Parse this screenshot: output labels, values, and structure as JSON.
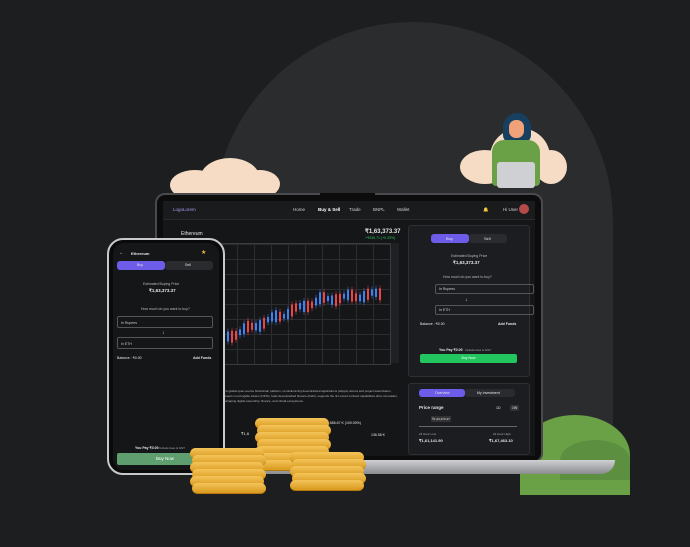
{
  "app": {
    "logo": "LogoLorem",
    "nav": [
      "Home",
      "Buy & Sell",
      "Trade",
      "BNPL",
      "Wallet"
    ],
    "user_greeting": "Hi User"
  },
  "market": {
    "asset": "Ethereum",
    "price": "₹1,63,373.37",
    "change": "+₹936.71 (+0.33%)",
    "description": "first global open-source blockchain platform, revolutionizing decentralized applications (dApps) across and project tokenization, powers non-fungible tokens (NFTs), fuels decentralized finance (DeFi), supports the rk's smart contract capabilities drive innovation, reshaping digital ownership, finance, and virtual ecosystems.",
    "stat_left": "₹1,6",
    "stat_right_a": "133,886.67 K (100.00%)",
    "stat_right_b": "136.58 K",
    "stat_right_c": "136.58 K",
    "range_label": "1D",
    "range_values": [
      "1W",
      "1M"
    ]
  },
  "trade_panel": {
    "tabs": [
      "Buy",
      "Sell"
    ],
    "estimated_label": "Estimated Buying Price",
    "estimated_price": "₹1,63,373.37",
    "question": "How much do you want to buy?",
    "in_rupees": "In Rupees",
    "in_eth": "In ETH",
    "balance_label": "Balance : ₹0.00",
    "add_funds": "Add Funds",
    "you_pay": "You Pay ₹0.00",
    "fees_note": "Include fees & GST",
    "buy_now": "Buy Now"
  },
  "overview": {
    "tabs": [
      "Overview",
      "My Investment"
    ],
    "price_range": "Price range",
    "range_btns": [
      "1D",
      "1W"
    ],
    "current_tag": "₹1,63,373.37",
    "low_label": "24 Hour Low",
    "low_value": "₹1,61,141.90",
    "high_label": "24 Hour High",
    "high_value": "₹1,67,463.10"
  },
  "phone": {
    "asset": "Ethereum",
    "tabs": [
      "Buy",
      "Sell"
    ],
    "estimated_label": "Estimated Buying Price",
    "estimated_price": "₹1,63,373.37",
    "question": "How much do you want to buy?",
    "in_rupees": "In Rupees",
    "in_eth": "In ETH",
    "balance_label": "Balance : ₹0.00",
    "add_funds": "Add Funds",
    "you_pay": "You Pay ₹0.00",
    "fees_note": "Include fees & GST",
    "buy_now": "Buy Now"
  },
  "colors": {
    "accent": "#6c5ce7",
    "buy_green": "#22c55e",
    "candle_up": "#3b82f6",
    "candle_down": "#ef4444",
    "coin": "#f2b544",
    "hill": "#6aa146",
    "cloud": "#f6dcc4"
  }
}
